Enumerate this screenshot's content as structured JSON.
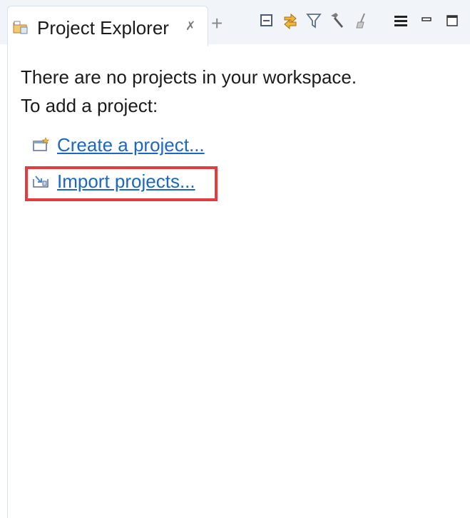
{
  "tab": {
    "title": "Project Explorer",
    "close_glyph": "✗",
    "new_tab_glyph": "+",
    "icon": "project-folder-icon"
  },
  "toolbar": {
    "icons": [
      "collapse-all-icon",
      "link-with-editor-icon",
      "filter-icon",
      "build-hammer-icon",
      "clean-broom-icon",
      "view-menu-icon",
      "minimize-icon",
      "maximize-icon"
    ]
  },
  "message": {
    "line1": "There are no projects in your workspace.",
    "line2": "To add a project:"
  },
  "links": {
    "create_label": "Create a project...",
    "import_label": "Import projects..."
  },
  "colors": {
    "link": "#1a67c7",
    "highlight": "#e53b3e",
    "tabbar": "#f1f4f9"
  }
}
